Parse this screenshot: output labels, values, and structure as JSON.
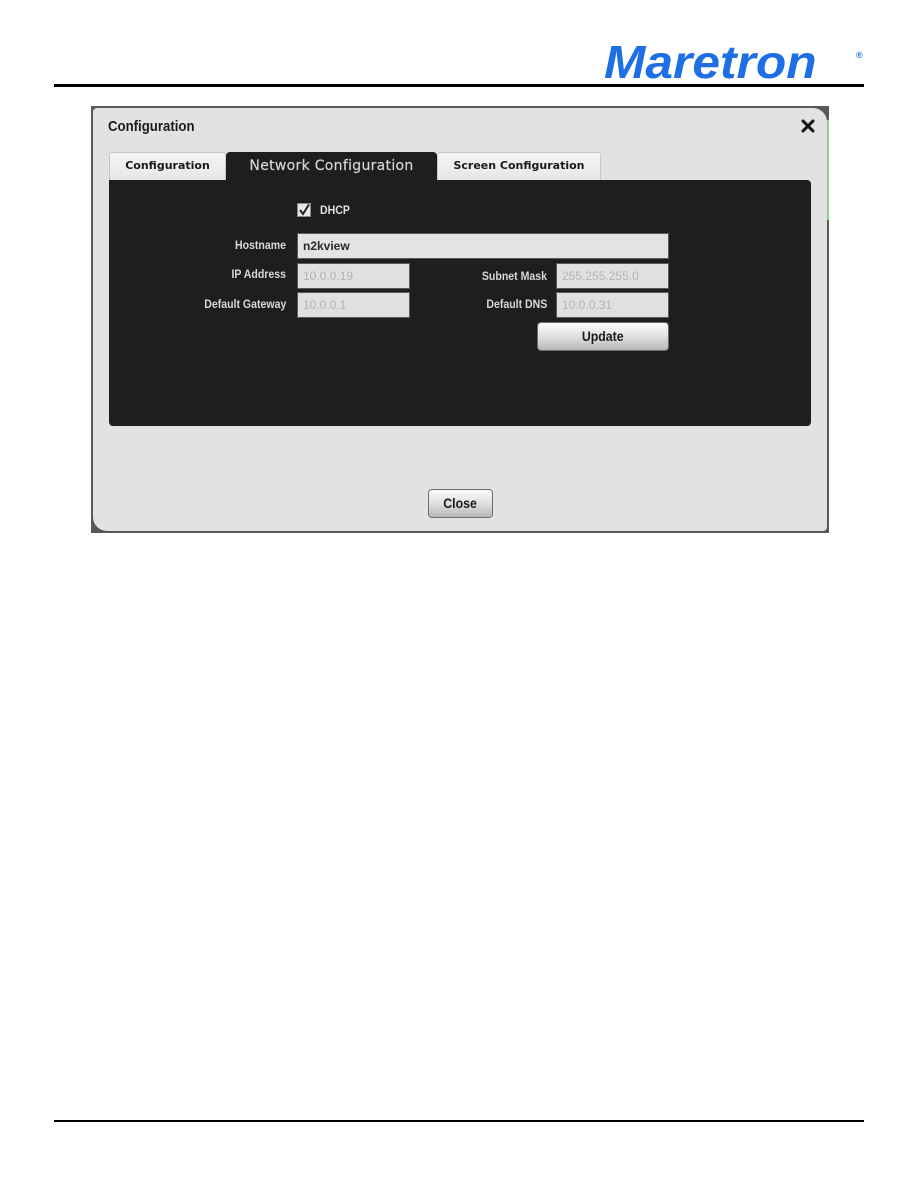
{
  "page": {
    "brand": "Maretron",
    "brand_mark": "®"
  },
  "dialog": {
    "title": "Configuration",
    "close_icon": "close-x-icon",
    "tabs": [
      {
        "label": "Configuration",
        "active": false
      },
      {
        "label": "Network Configuration",
        "active": true
      },
      {
        "label": "Screen Configuration",
        "active": false
      }
    ],
    "network": {
      "dhcp": {
        "label": "DHCP",
        "checked": true
      },
      "hostname": {
        "label": "Hostname",
        "value": "n2kview"
      },
      "ip_address": {
        "label": "IP Address",
        "value": "10.0.0.19"
      },
      "subnet_mask": {
        "label": "Subnet Mask",
        "value": "255.255.255.0"
      },
      "default_gateway": {
        "label": "Default Gateway",
        "value": "10.0.0.1"
      },
      "default_dns": {
        "label": "Default DNS",
        "value": "10.0.0.31"
      },
      "update_label": "Update"
    },
    "close_label": "Close"
  },
  "colors": {
    "brand_blue": "#1e6ee6",
    "panel_dark": "#1e1e1e",
    "dialog_bg": "#e2e2e2"
  }
}
